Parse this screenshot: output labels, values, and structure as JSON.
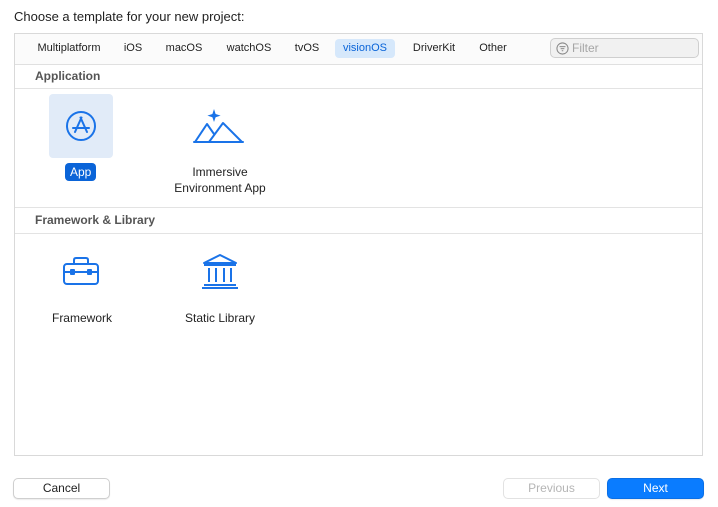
{
  "header": {
    "title": "Choose a template for your new project:"
  },
  "tabs": [
    {
      "label": "Multiplatform",
      "selected": false
    },
    {
      "label": "iOS",
      "selected": false
    },
    {
      "label": "macOS",
      "selected": false
    },
    {
      "label": "watchOS",
      "selected": false
    },
    {
      "label": "tvOS",
      "selected": false
    },
    {
      "label": "visionOS",
      "selected": true
    },
    {
      "label": "DriverKit",
      "selected": false
    },
    {
      "label": "Other",
      "selected": false
    }
  ],
  "filter": {
    "placeholder": "Filter",
    "value": "",
    "icon": "filter-icon"
  },
  "sections": [
    {
      "title": "Application",
      "templates": [
        {
          "label": "App",
          "icon": "app-store-icon",
          "selected": true
        },
        {
          "label": "Immersive Environment App",
          "label_lines": [
            "Immersive",
            "Environment App"
          ],
          "icon": "mountains-sparkle-icon",
          "selected": false
        }
      ]
    },
    {
      "title": "Framework & Library",
      "templates": [
        {
          "label": "Framework",
          "icon": "toolbox-icon",
          "selected": false
        },
        {
          "label": "Static Library",
          "icon": "building-columns-icon",
          "selected": false
        }
      ]
    }
  ],
  "buttons": {
    "cancel": "Cancel",
    "previous": "Previous",
    "previous_enabled": false,
    "next": "Next"
  },
  "colors": {
    "accent": "#0a64d8",
    "primary_button": "#0a7cff",
    "selected_tab_bg": "#d6e8fb",
    "icon_blue": "#1a73e8"
  }
}
